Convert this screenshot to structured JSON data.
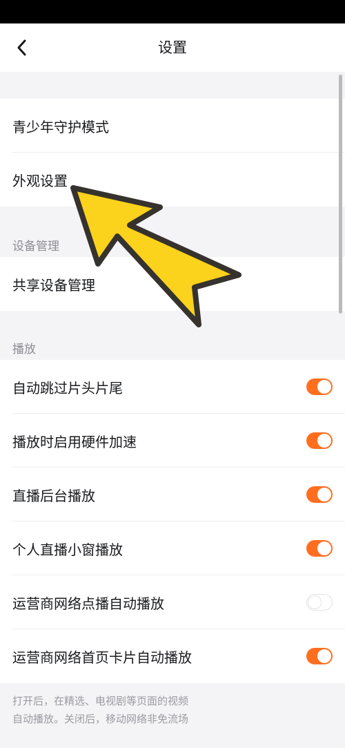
{
  "nav": {
    "title": "设置",
    "back_icon": "chevron-left-icon"
  },
  "group_top": {
    "items": [
      {
        "label": "青少年守护模式"
      },
      {
        "label": "外观设置"
      }
    ]
  },
  "device_section": {
    "header": "设备管理",
    "items": [
      {
        "label": "共享设备管理"
      }
    ]
  },
  "playback_section": {
    "header": "播放",
    "items": [
      {
        "label": "自动跳过片头片尾",
        "enabled": true
      },
      {
        "label": "播放时启用硬件加速",
        "enabled": true
      },
      {
        "label": "直播后台播放",
        "enabled": true
      },
      {
        "label": "个人直播小窗播放",
        "enabled": true
      },
      {
        "label": "运营商网络点播自动播放",
        "enabled": false
      },
      {
        "label": "运营商网络首页卡片自动播放",
        "enabled": true
      }
    ],
    "note_line1": "打开后，在精选、电视剧等页面的视频",
    "note_line2": "自动播放。关闭后，移动网络非免流场"
  },
  "colors": {
    "accent": "#ff6e1f",
    "arrow_fill": "#fbd21c",
    "arrow_stroke": "#36322e",
    "background": "#f4f4f6"
  },
  "overlay": {
    "icon": "yellow-pointer-arrow-icon"
  }
}
